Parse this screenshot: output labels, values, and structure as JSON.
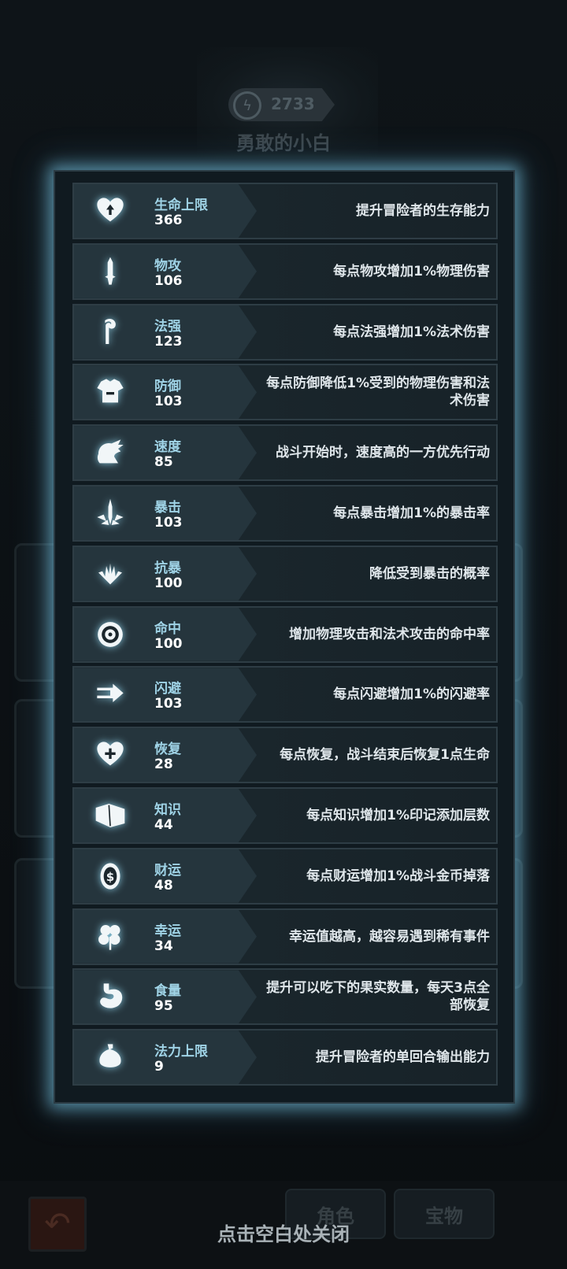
{
  "background": {
    "score": "2733",
    "hero_name": "勇敢的小白",
    "tabs": [
      "角色",
      "宝物"
    ]
  },
  "close_hint": "点击空白处关闭",
  "stats": [
    {
      "icon": "heart-up-icon",
      "name": "生命上限",
      "value": "366",
      "desc": "提升冒险者的生存能力"
    },
    {
      "icon": "sword-icon",
      "name": "物攻",
      "value": "106",
      "desc": "每点物攻增加1%物理伤害"
    },
    {
      "icon": "staff-icon",
      "name": "法强",
      "value": "123",
      "desc": "每点法强增加1%法术伤害"
    },
    {
      "icon": "armor-icon",
      "name": "防御",
      "value": "103",
      "desc": "每点防御降低1%受到的物理伤害和法术伤害"
    },
    {
      "icon": "wing-boot-icon",
      "name": "速度",
      "value": "85",
      "desc": "战斗开始时，速度高的一方优先行动"
    },
    {
      "icon": "dagger-burst-icon",
      "name": "暴击",
      "value": "103",
      "desc": "每点暴击增加1%的暴击率"
    },
    {
      "icon": "shield-burst-icon",
      "name": "抗暴",
      "value": "100",
      "desc": "降低受到暴击的概率"
    },
    {
      "icon": "target-icon",
      "name": "命中",
      "value": "100",
      "desc": "增加物理攻击和法术攻击的命中率"
    },
    {
      "icon": "dodge-arrow-icon",
      "name": "闪避",
      "value": "103",
      "desc": "每点闪避增加1%的闪避率"
    },
    {
      "icon": "heart-plus-icon",
      "name": "恢复",
      "value": "28",
      "desc": "每点恢复，战斗结束后恢复1点生命"
    },
    {
      "icon": "book-icon",
      "name": "知识",
      "value": "44",
      "desc": "每点知识增加1%印记添加层数"
    },
    {
      "icon": "coin-icon",
      "name": "财运",
      "value": "48",
      "desc": "每点财运增加1%战斗金币掉落"
    },
    {
      "icon": "clover-icon",
      "name": "幸运",
      "value": "34",
      "desc": "幸运值越高，越容易遇到稀有事件"
    },
    {
      "icon": "stomach-icon",
      "name": "食量",
      "value": "95",
      "desc": "提升可以吃下的果实数量，每天3点全部恢复"
    },
    {
      "icon": "mana-flask-icon",
      "name": "法力上限",
      "value": "9",
      "desc": "提升冒险者的单回合输出能力"
    }
  ]
}
